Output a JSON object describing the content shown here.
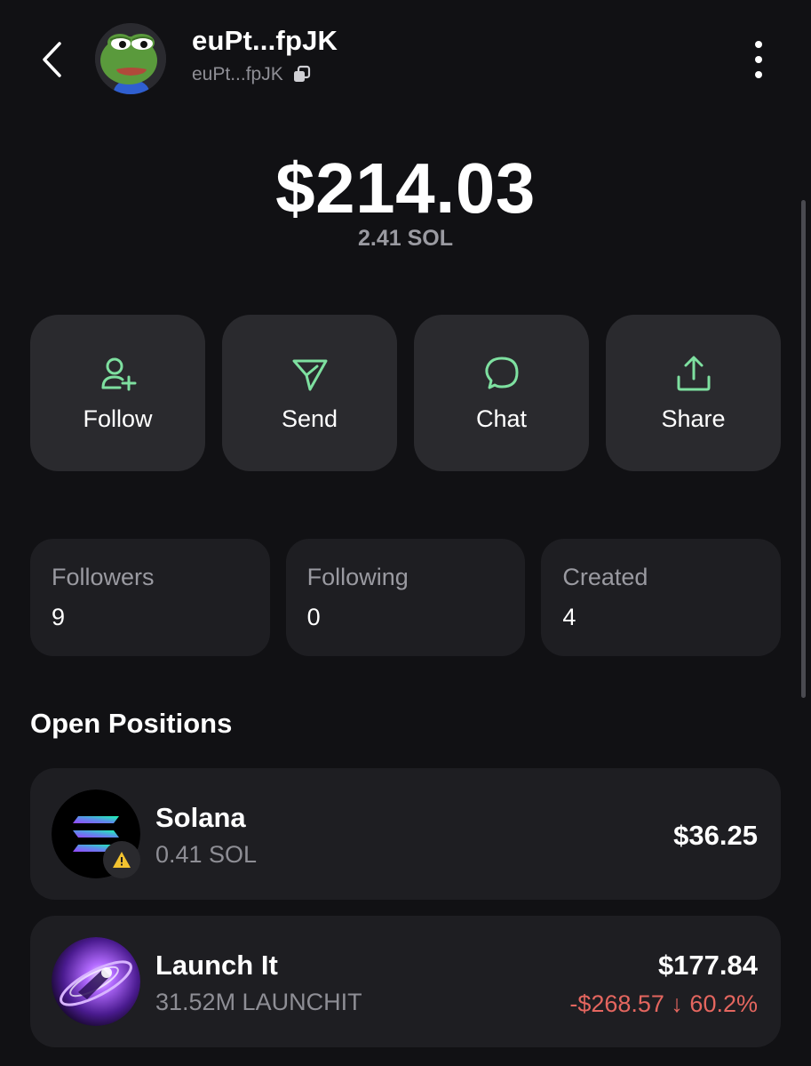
{
  "header": {
    "name": "euPt...fpJK",
    "address": "euPt...fpJK"
  },
  "balance": {
    "usd": "$214.03",
    "sol": "2.41 SOL"
  },
  "actions": [
    {
      "label": "Follow",
      "icon": "user-plus-icon"
    },
    {
      "label": "Send",
      "icon": "send-icon"
    },
    {
      "label": "Chat",
      "icon": "chat-icon"
    },
    {
      "label": "Share",
      "icon": "share-icon"
    }
  ],
  "stats": [
    {
      "label": "Followers",
      "value": "9"
    },
    {
      "label": "Following",
      "value": "0"
    },
    {
      "label": "Created",
      "value": "4"
    }
  ],
  "positions_title": "Open Positions",
  "positions": [
    {
      "name": "Solana",
      "amount": "0.41 SOL",
      "value": "$36.25",
      "change": ""
    },
    {
      "name": "Launch It",
      "amount": "31.52M LAUNCHIT",
      "value": "$177.84",
      "change": "-$268.57 ↓ 60.2%"
    }
  ],
  "colors": {
    "background": "#111114",
    "card": "#2a2a2e",
    "stat_card": "#1e1e22",
    "accent_green": "#7ee0a0",
    "negative": "#e4665f",
    "muted": "#8e8e95"
  }
}
